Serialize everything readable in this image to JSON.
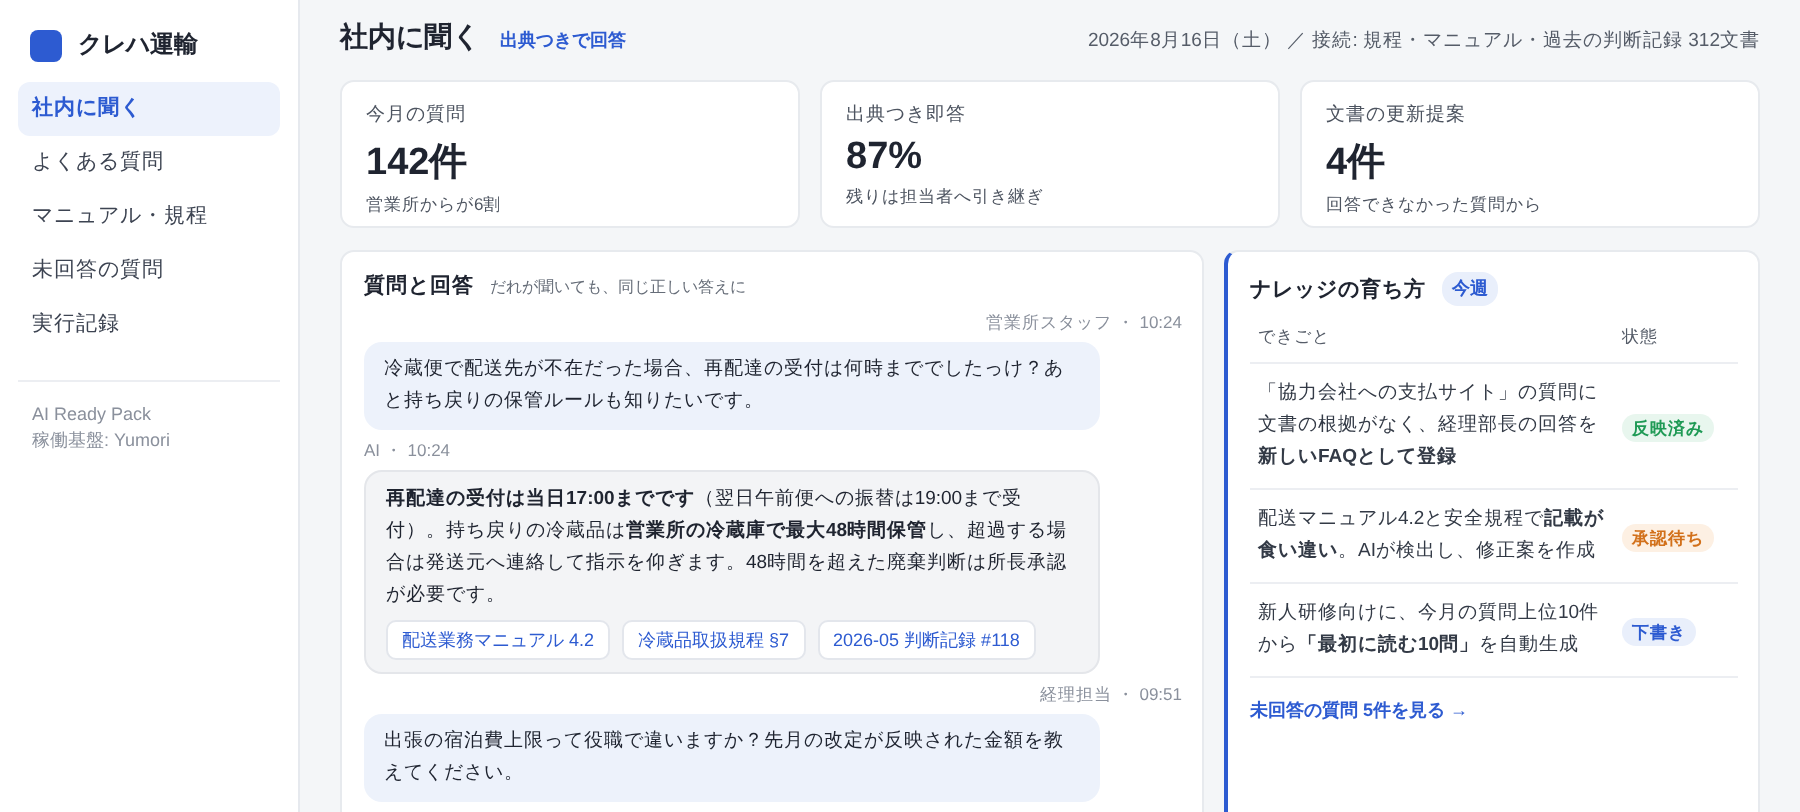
{
  "brand": {
    "name": "クレハ運輸"
  },
  "sidebar": {
    "items": [
      {
        "label": "社内に聞く",
        "selected": true
      },
      {
        "label": "よくある質問",
        "selected": false
      },
      {
        "label": "マニュアル・規程",
        "selected": false
      },
      {
        "label": "未回答の質問",
        "selected": false
      },
      {
        "label": "実行記録",
        "selected": false
      }
    ],
    "footer": [
      "AI Ready Pack",
      "稼働基盤: Yumori"
    ]
  },
  "header": {
    "title": "社内に聞く",
    "subtitle": "出典つきで回答",
    "info": "2026年8月16日（土） ／ 接続: 規程・マニュアル・過去の判断記録 312文書"
  },
  "stats": [
    {
      "label": "今月の質問",
      "value": "142件",
      "note": "営業所からが6割"
    },
    {
      "label": "出典つき即答",
      "value": "87%",
      "note": "残りは担当者へ引き継ぎ"
    },
    {
      "label": "文書の更新提案",
      "value": "4件",
      "note": "回答できなかった質問から"
    }
  ],
  "chat": {
    "title": "質問と回答",
    "subtitle": "だれが聞いても、同じ正しい答えに",
    "messages": [
      {
        "kind": "user",
        "meta": "営業所スタッフ ・ 10:24",
        "text": "冷蔵便で配送先が不在だった場合、再配達の受付は何時まででしたっけ？あと持ち戻りの保管ルールも知りたいです。"
      },
      {
        "kind": "ai",
        "meta": "AI ・ 10:24",
        "text": "**再配達の受付は当日17:00までです**（翌日午前便への振替は19:00まで受付）。持ち戻りの冷蔵品は**営業所の冷蔵庫で最大48時間保管**し、超過する場合は発送元へ連絡して指示を仰ぎます。48時間を超えた廃棄判断は所長承認が必要です。",
        "sources": [
          "配送業務マニュアル 4.2",
          "冷蔵品取扱規程 §7",
          "2026-05 判断記録 #118"
        ]
      },
      {
        "kind": "user",
        "meta": "経理担当 ・ 09:51",
        "text": "出張の宿泊費上限って役職で違いますか？先月の改定が反映された金額を教えてください。"
      }
    ]
  },
  "knowledge": {
    "title": "ナレッジの育ち方",
    "badge": "今週",
    "columns": [
      "できごと",
      "状態"
    ],
    "rows": [
      {
        "text": "「協力会社への支払サイト」の質問に文書の根拠がなく、経理部長の回答を**新しいFAQとして登録**",
        "status": "反映済み",
        "kind": "done"
      },
      {
        "text": "配送マニュアル4.2と安全規程で**記載が食い違い**。AIが検出し、修正案を作成",
        "status": "承認待ち",
        "kind": "pending"
      },
      {
        "text": "新人研修向けに、今月の質問上位10件から**「最初に読む10問」**を自動生成",
        "status": "下書き",
        "kind": "draft"
      }
    ],
    "link": "未回答の質問 5件を見る →"
  }
}
